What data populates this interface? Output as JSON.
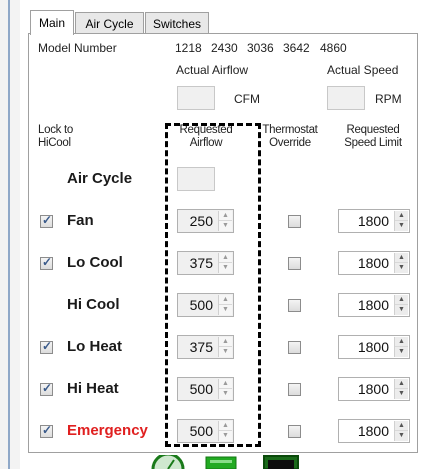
{
  "tabs": [
    "Main",
    "Air Cycle",
    "Switches"
  ],
  "model": {
    "label": "Model Number",
    "numbers": [
      "1218",
      "2430",
      "3036",
      "3642",
      "4860"
    ]
  },
  "actual": {
    "airflow_label": "Actual Airflow",
    "airflow_unit": "CFM",
    "speed_label": "Actual Speed",
    "speed_unit": "RPM"
  },
  "headers": {
    "lock_line1": "Lock to",
    "lock_line2": "HiCool",
    "req_airflow_line1": "Requested",
    "req_airflow_line2": "Airflow",
    "override_line1": "Thermostat",
    "override_line2": "Override",
    "speed_limit_line1": "Requested",
    "speed_limit_line2": "Speed Limit"
  },
  "air_cycle_label": "Air Cycle",
  "rows": [
    {
      "label": "Fan",
      "airflow": "250",
      "speed": "1800",
      "lock": true
    },
    {
      "label": "Lo Cool",
      "airflow": "375",
      "speed": "1800",
      "lock": true
    },
    {
      "label": "Hi Cool",
      "airflow": "500",
      "speed": "1800",
      "lock": false
    },
    {
      "label": "Lo Heat",
      "airflow": "375",
      "speed": "1800",
      "lock": true
    },
    {
      "label": "Hi Heat",
      "airflow": "500",
      "speed": "1800",
      "lock": true
    },
    {
      "label": "Emergency",
      "airflow": "500",
      "speed": "1800",
      "lock": true
    }
  ],
  "colors": {
    "emergency": "#e02020",
    "accent": "#3a5a8a"
  }
}
